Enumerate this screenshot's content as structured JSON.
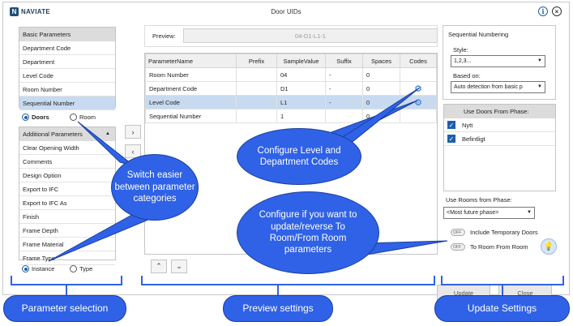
{
  "window": {
    "title": "Door UIDs",
    "logo_text": "NAVIATE",
    "logo_letter": "N",
    "info_glyph": "i",
    "close_glyph": "×"
  },
  "left_panel": {
    "basic_header": "Basic Parameters",
    "basic_items": [
      "Department Code",
      "Department",
      "Level Code",
      "Room Number",
      "Sequential Number"
    ],
    "category_options": [
      "Doors",
      "Room"
    ],
    "additional_header": "Additional Parameters",
    "additional_items": [
      "Clear Opening Width",
      "Comments",
      "Design Option",
      "Export to IFC",
      "Export to IFC As",
      "Finish",
      "Frame Depth",
      "Frame Material",
      "Frame Type"
    ],
    "scope_options": [
      "Instance",
      "Type"
    ],
    "move_right_glyph": "›",
    "move_left_glyph": "‹"
  },
  "preview": {
    "label": "Preview:",
    "value": "04-D1-L1-1",
    "columns": [
      "ParameterName",
      "Prefix",
      "SampleValue",
      "Suffix",
      "Spaces",
      "Codes"
    ],
    "rows": [
      {
        "name": "Room Number",
        "prefix": "",
        "sample": "04",
        "suffix": "-",
        "spaces": "0",
        "codes": ""
      },
      {
        "name": "Department Code",
        "prefix": "",
        "sample": "D1",
        "suffix": "-",
        "spaces": "0",
        "codes": "⚙"
      },
      {
        "name": "Level Code",
        "prefix": "",
        "sample": "L1",
        "suffix": "-",
        "spaces": "0",
        "codes": "⚙"
      },
      {
        "name": "Sequential Number",
        "prefix": "",
        "sample": "1",
        "suffix": "",
        "spaces": "0",
        "codes": ""
      }
    ],
    "up_glyph": "⌃",
    "down_glyph": "⌄"
  },
  "right_panel": {
    "seq_title": "Sequential Numbering",
    "style_label": "Style:",
    "style_value": "1,2,3...",
    "based_on_label": "Based on:",
    "based_on_value": "Auto detection from basic p",
    "phase_header": "Use Doors From Phase:",
    "phases": [
      "Nytt",
      "Befintligt"
    ],
    "rooms_phase_label": "Use Rooms from Phase:",
    "rooms_phase_value": "<Most future phase>",
    "toggles": [
      {
        "state": "OFF",
        "label": "Include Temporary Doors"
      },
      {
        "state": "OFF",
        "label": "To Room From Room"
      }
    ],
    "update_button": "Update",
    "close_button": "Close"
  },
  "callouts": {
    "switch": "Switch easier between parameter categories",
    "configure_codes": "Configure Level and Department Codes",
    "configure_reverse": "Configure if you want to update/reverse To Room/From Room parameters",
    "parameter_selection": "Parameter selection",
    "preview_settings": "Preview settings",
    "update_settings": "Update Settings"
  },
  "colors": {
    "callout": "#2f62e6",
    "selection": "#c7daf0",
    "accent": "#1f5fa8"
  }
}
